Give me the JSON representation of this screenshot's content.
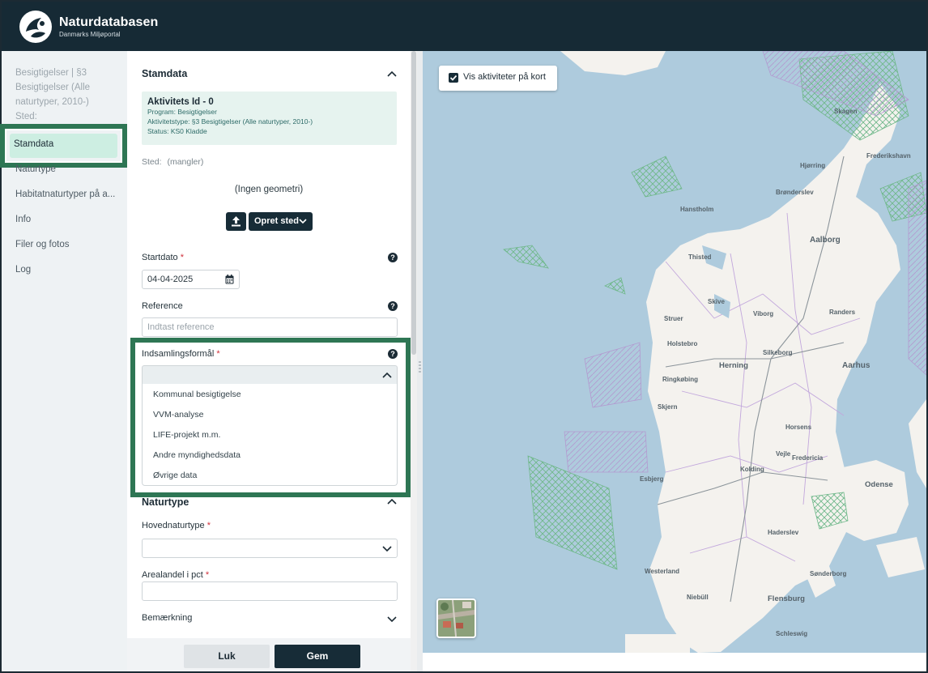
{
  "header": {
    "title": "Naturdatabasen",
    "subtitle": "Danmarks Miljøportal"
  },
  "sidebar": {
    "heading": "Besigtigelser | §3 Besigtigelser (Alle naturtyper, 2010-) Sted:",
    "items": [
      {
        "label": "Stamdata",
        "active": true
      },
      {
        "label": "Naturtype"
      },
      {
        "label": "Habitatnaturtyper på a..."
      },
      {
        "label": "Info"
      },
      {
        "label": "Filer og fotos"
      },
      {
        "label": "Log"
      }
    ]
  },
  "stamdata": {
    "title": "Stamdata",
    "activity_title": "Aktivitets Id - 0",
    "program": "Program: Besigtigelser",
    "aktivitetstype": "Aktivitetstype: §3 Besigtigelser (Alle naturtyper, 2010-)",
    "status": "Status: KS0 Kladde",
    "sted_label": "Sted:",
    "sted_value": "(mangler)",
    "no_geometry": "(Ingen geometri)",
    "create_place_label": "Opret sted",
    "startdato_label": "Startdato",
    "startdato_value": "04-04-2025",
    "reference_label": "Reference",
    "reference_placeholder": "Indtast reference",
    "indsamling_label": "Indsamlingsformål",
    "indsamling_options": [
      "Kommunal besigtigelse",
      "VVM-analyse",
      "LIFE-projekt m.m.",
      "Andre myndighedsdata",
      "Øvrige data"
    ]
  },
  "naturtype": {
    "title": "Naturtype",
    "hoved_label": "Hovednaturtype",
    "areal_label": "Arealandel i pct",
    "bemaerkning_label": "Bemærkning"
  },
  "required_mark": "*",
  "help_mark": "?",
  "footer": {
    "close_label": "Luk",
    "save_label": "Gem"
  },
  "map": {
    "toggle_label": "Vis aktiviteter på kort",
    "toggle_checked": true,
    "places": [
      "Skagen",
      "Frederikshavn",
      "Hjørring",
      "Brønderslev",
      "Hanstholm",
      "Aalborg",
      "Thisted",
      "Skive",
      "Viborg",
      "Randers",
      "Struer",
      "Holstebro",
      "Silkeborg",
      "Aarhus",
      "Herning",
      "Ringkøbing",
      "Skjern",
      "Horsens",
      "Vejle",
      "Fredericia",
      "Kolding",
      "Esbjerg",
      "Odense",
      "Haderslev",
      "Westerland",
      "Sønderborg",
      "Niebüll",
      "Flensburg",
      "Schleswig"
    ]
  },
  "colors": {
    "header_bg": "#162a35",
    "accent_green": "#2e7654",
    "map_water": "#aecbdd",
    "map_land": "#f4f2ee",
    "required": "#d0303b"
  }
}
